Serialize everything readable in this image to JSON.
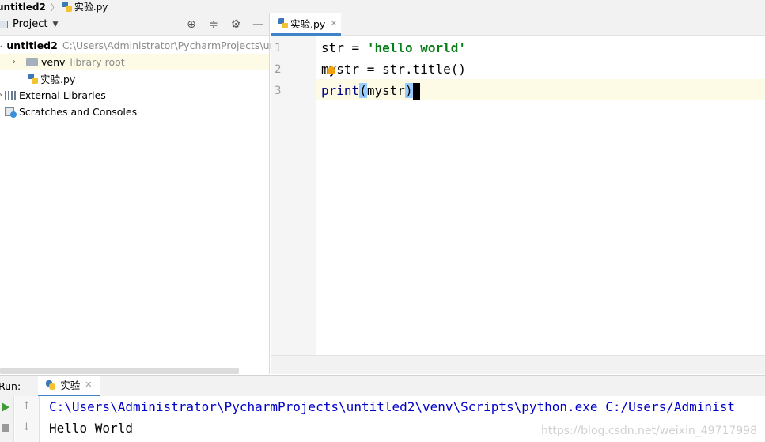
{
  "navbar": {
    "root": "untitled2",
    "file": "实验.py"
  },
  "project_panel": {
    "title": "Project",
    "tools": [
      "locate-icon",
      "collapse-icon",
      "gear-icon",
      "minimize-icon"
    ],
    "tree": {
      "root_name": "untitled2",
      "root_path": "C:\\Users\\Administrator\\PycharmProjects\\ur",
      "venv_name": "venv",
      "venv_note": "library root",
      "file_name": "实验.py",
      "ext_libs": "External Libraries",
      "scratches": "Scratches and Consoles"
    }
  },
  "editor": {
    "tab_label": "实验.py",
    "line_numbers": [
      "1",
      "2",
      "3"
    ],
    "line1": {
      "ident": "str",
      "op": " = ",
      "str": "'hello world'"
    },
    "line2": {
      "text": "mystr = str.title()"
    },
    "line3": {
      "fn": "print",
      "open": "(",
      "arg": "mystr",
      "close": ")"
    }
  },
  "run": {
    "label": "Run:",
    "tab_label": "实验",
    "output_path": "C:\\Users\\Administrator\\PycharmProjects\\untitled2\\venv\\Scripts\\python.exe C:/Users/Administ",
    "output_text": "Hello World",
    "watermark": "https://blog.csdn.net/weixin_49717998"
  },
  "colors": {
    "string": "#067d17",
    "accent_tab": "#4083c9",
    "current_line": "#fdfbe6",
    "bracket_highlight": "#99ccff"
  }
}
